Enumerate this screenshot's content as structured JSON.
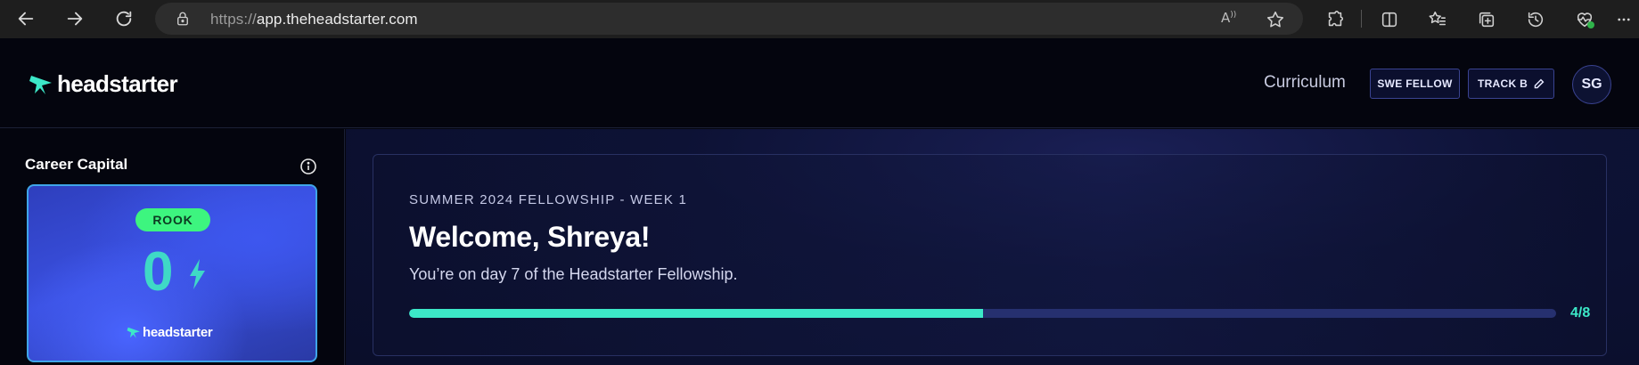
{
  "browser": {
    "url_protocol": "https://",
    "url_host": "app.theheadstarter.com",
    "read_aloud_icon": "read-aloud-icon",
    "favorite_icon": "star-icon"
  },
  "header": {
    "logo_text": "headstarter",
    "nav_link": "Curriculum",
    "role_button": "SWE FELLOW",
    "track_button": "TRACK B",
    "avatar_initials": "SG"
  },
  "sidebar": {
    "title": "Career Capital",
    "card": {
      "rank": "ROOK",
      "value": "0",
      "logo_text": "headstarter"
    }
  },
  "main": {
    "week_label": "SUMMER 2024 FELLOWSHIP - WEEK 1",
    "title": "Welcome, Shreya!",
    "subtitle": "You’re on day 7 of the Headstarter Fellowship.",
    "progress": {
      "current": 4,
      "total": 8,
      "label": "4/8"
    }
  },
  "colors": {
    "accent_teal": "#3ce8c8",
    "rank_green": "#3df57f",
    "card_blue": "#3a50e0"
  }
}
